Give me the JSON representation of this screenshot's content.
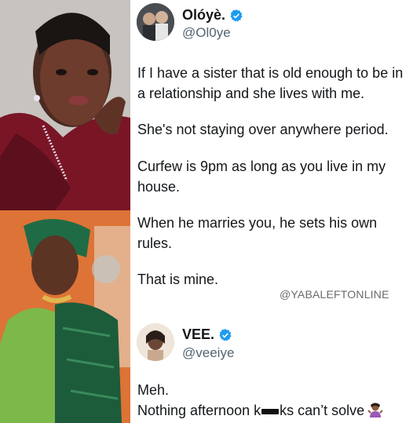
{
  "tweets": [
    {
      "display_name": "Olóyè.",
      "handle": "@Ol0ye",
      "verified": true,
      "paragraphs": [
        "If I have a sister that is old enough to be in a relationship and she lives with me.",
        "She's not staying over anywhere period.",
        "Curfew is 9pm as long as you live in my house.",
        "When he marries you, he sets his own rules.",
        "That is mine."
      ]
    },
    {
      "display_name": "VEE.",
      "handle": "@veeiye",
      "verified": true,
      "lines": [
        "Meh.",
        "Nothing afternoon k",
        "ks can’t solve"
      ],
      "emoji": "woman-shrugging-emoji"
    }
  ],
  "watermark": "@YABALEFTONLINE",
  "colors": {
    "verified": "#1d9bf0",
    "text": "#14171a",
    "secondary": "#536471",
    "dress_top": "#7a1526",
    "background_bottom": "#e07638",
    "fabric_green": "#1f6b45"
  }
}
